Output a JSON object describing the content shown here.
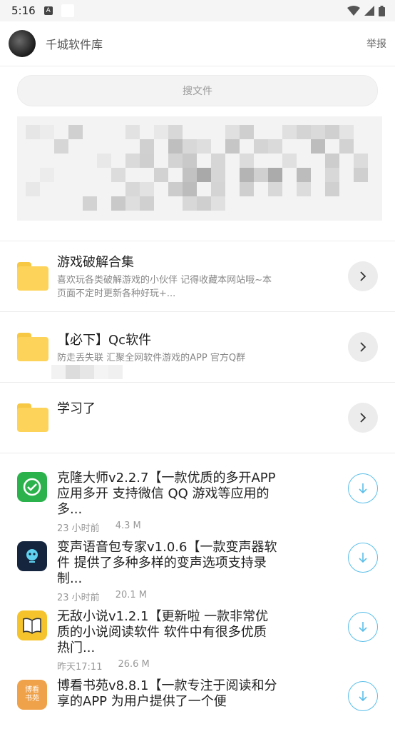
{
  "status_bar": {
    "time": "5:16",
    "badge": "A"
  },
  "header": {
    "title": "千城软件库",
    "report_label": "举报"
  },
  "search": {
    "placeholder": "搜文件"
  },
  "folders": [
    {
      "title": "游戏破解合集",
      "description": "喜欢玩各类破解游戏的小伙伴 记得收藏本网站哦~本页面不定时更新各种好玩+..."
    },
    {
      "title": "【必下】Qc软件",
      "description": "防走丢失联 汇聚全网软件游戏的APP 官方Q群"
    },
    {
      "title": "学习了",
      "description": ""
    }
  ],
  "apps": [
    {
      "title": "克隆大师v2.2.7【一款优质的多开APP 应用多开 支持微信 QQ 游戏等应用的多...",
      "time": "23 小时前",
      "size": "4.3 M",
      "icon": "clone-master-icon",
      "icon_color": "#2bb24c"
    },
    {
      "title": "变声语音包专家v1.0.6【一款变声器软件 提供了多种多样的变声选项支持录制...",
      "time": "23 小时前",
      "size": "20.1 M",
      "icon": "voice-changer-icon",
      "icon_color": "#15253e"
    },
    {
      "title": "无敌小说v1.2.1【更新啦 一款非常优质的小说阅读软件 软件中有很多优质热门...",
      "time": "昨天17:11",
      "size": "26.6 M",
      "icon": "book-icon",
      "icon_color": "#f5c42c"
    },
    {
      "title": "博看书苑v8.8.1【一款专注于阅读和分享的APP 为用户提供了一个便",
      "time": "",
      "size": "",
      "icon": "bokan-icon",
      "icon_color": "#f0a24a",
      "icon_text": "博看书苑"
    }
  ],
  "colors": {
    "accent": "#5bbfea",
    "folder": "#fdd35a"
  }
}
